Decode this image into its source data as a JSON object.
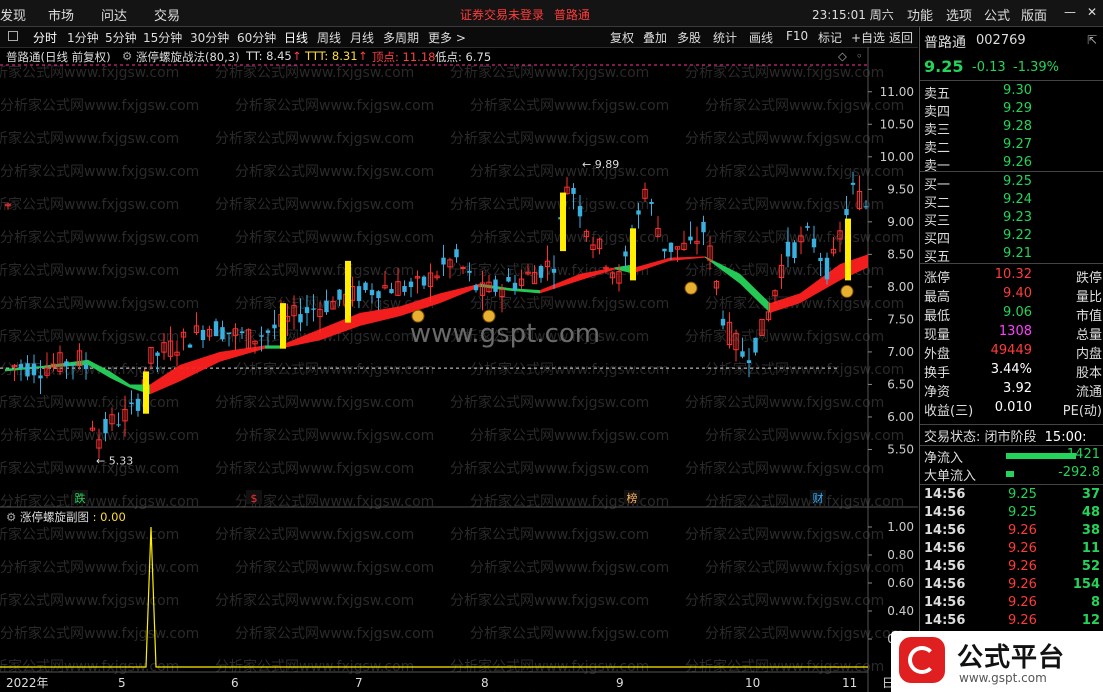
{
  "topbar": {
    "menu_left": [
      "发现",
      "市场",
      "问达",
      "交易"
    ],
    "notice": "证券交易未登录",
    "notice_stock": "普路通",
    "clock": "23:15:01 周六",
    "menu_right": [
      "功能",
      "选项",
      "公式",
      "版面"
    ]
  },
  "toolbar": {
    "periods": [
      "分时",
      "1分钟",
      "5分钟",
      "15分钟",
      "30分钟",
      "60分钟",
      "日线",
      "周线",
      "月线",
      "多周期",
      "更多 >"
    ],
    "active_period": "日线",
    "tools": [
      "复权",
      "叠加",
      "多股",
      "统计",
      "画线",
      "F10",
      "标记",
      "+自选",
      "返回"
    ]
  },
  "infobar": {
    "title": "普路通(日线 前复权)",
    "indicator": "涨停螺旋战法(80,3)",
    "tt": "TT: 8.45",
    "ttt": "TTT: 8.31",
    "top": "顶点: 11.18",
    "low": "低点: 6.75"
  },
  "sub_indicator": {
    "name": "涨停螺旋副图",
    "value": ": 0.00",
    "ylabels": [
      "1.00",
      "0.80",
      "0.60",
      "0.40",
      "0.20"
    ],
    "spike_value": 1.0
  },
  "main_chart": {
    "ylabels": [
      "11.00",
      "10.50",
      "10.00",
      "9.50",
      "9.00",
      "8.50",
      "8.00",
      "7.50",
      "7.00",
      "6.50",
      "6.00",
      "5.50"
    ],
    "ymin": 5.0,
    "ymax": 11.35,
    "xlabels": [
      "2022年",
      "5",
      "6",
      "7",
      "8",
      "9",
      "10",
      "11"
    ],
    "corner_label": "日",
    "hi_label": "9.89",
    "lo_label": "5.33",
    "dashed_level": 6.75,
    "event_labels": [
      "跌",
      "$",
      "榜",
      "财"
    ],
    "watermark": "www.gspt.com",
    "watermark_pattern": "分析家公式网www.fxjgsw.com"
  },
  "quote": {
    "name": "普路通",
    "code": "002769",
    "price": "9.25",
    "change": "-0.13",
    "change_pct": "-1.39%",
    "asks": [
      {
        "label": "卖五",
        "price": "9.30"
      },
      {
        "label": "卖四",
        "price": "9.29"
      },
      {
        "label": "卖三",
        "price": "9.28"
      },
      {
        "label": "卖二",
        "price": "9.27"
      },
      {
        "label": "卖一",
        "price": "9.26"
      }
    ],
    "bids": [
      {
        "label": "买一",
        "price": "9.25"
      },
      {
        "label": "买二",
        "price": "9.24"
      },
      {
        "label": "买三",
        "price": "9.23"
      },
      {
        "label": "买四",
        "price": "9.22"
      },
      {
        "label": "买五",
        "price": "9.21"
      }
    ],
    "stats": [
      {
        "label": "涨停",
        "value": "10.32",
        "right": "跌停",
        "color": "red"
      },
      {
        "label": "最高",
        "value": "9.40",
        "right": "量比",
        "color": "red"
      },
      {
        "label": "最低",
        "value": "9.06",
        "right": "市值",
        "color": "green"
      },
      {
        "label": "现量",
        "value": "1308",
        "right": "总量",
        "color": "magenta"
      },
      {
        "label": "外盘",
        "value": "49449",
        "right": "内盘",
        "color": "red"
      },
      {
        "label": "换手",
        "value": "3.44%",
        "right": "股本",
        "color": "white"
      },
      {
        "label": "净资",
        "value": "3.92",
        "right": "流通",
        "color": "white"
      },
      {
        "label": "收益(三)",
        "value": "0.010",
        "right": "PE(动)",
        "color": "white"
      }
    ],
    "trade_status": "交易状态: 闭市阶段",
    "trade_time": "15:00:",
    "flows": [
      {
        "label": "净流入",
        "value": "-1421"
      },
      {
        "label": "大单流入",
        "value": "-292.8"
      }
    ],
    "ticks": [
      {
        "time": "14:56",
        "price": "9.25",
        "vol": "37",
        "c": "green"
      },
      {
        "time": "14:56",
        "price": "9.25",
        "vol": "48",
        "c": "green"
      },
      {
        "time": "14:56",
        "price": "9.26",
        "vol": "38",
        "c": "red"
      },
      {
        "time": "14:56",
        "price": "9.26",
        "vol": "11",
        "c": "red"
      },
      {
        "time": "14:56",
        "price": "9.26",
        "vol": "52",
        "c": "red"
      },
      {
        "time": "14:56",
        "price": "9.26",
        "vol": "154",
        "c": "red"
      },
      {
        "time": "14:56",
        "price": "9.26",
        "vol": "8",
        "c": "red"
      },
      {
        "time": "14:56",
        "price": "9.26",
        "vol": "12",
        "c": "red"
      }
    ]
  },
  "logo": {
    "text": "公式平台",
    "sub": "www.gspt.com"
  }
}
